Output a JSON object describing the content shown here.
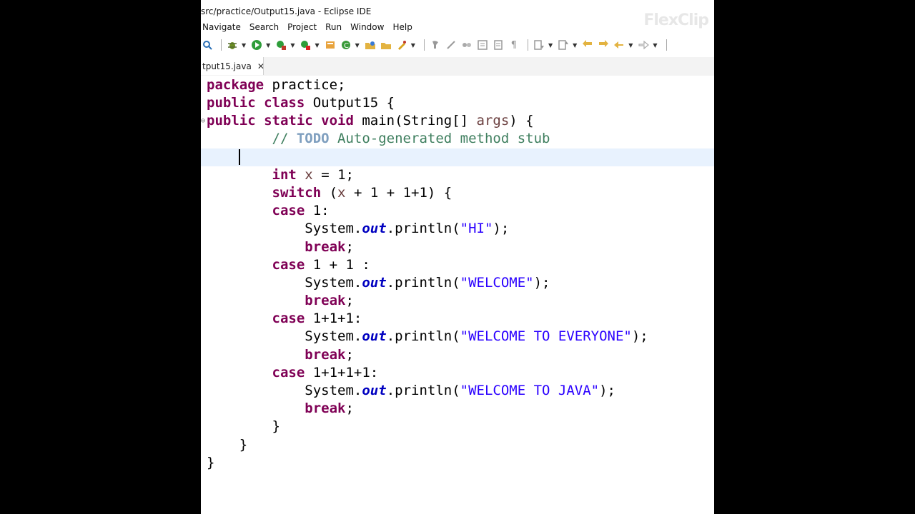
{
  "window": {
    "title": "src/practice/Output15.java - Eclipse IDE",
    "watermark": "FlexClip"
  },
  "menu": [
    "Navigate",
    "Search",
    "Project",
    "Run",
    "Window",
    "Help"
  ],
  "toolbar": {
    "icons": [
      "search-icon",
      "debug-icon",
      "run-icon",
      "coverage-icon",
      "external-tools-icon",
      "new-java-project-icon",
      "new-class-icon",
      "open-type-icon",
      "open-task-icon",
      "next-annotation-icon",
      "prev-annotation-icon",
      "highlight-icon",
      "toggle-block-icon",
      "show-whitespace-icon",
      "last-edit-icon",
      "next-edit-icon",
      "back-icon",
      "forward-icon"
    ]
  },
  "editor_tab": {
    "label": "tput15.java",
    "close": "✕"
  },
  "code": {
    "package_kw": "package",
    "package_name": " practice;",
    "public_kw": "public",
    "class_kw": " class",
    "class_name": " Output15 {",
    "static_kw": " static",
    "void_kw": " void",
    "main_sig": " main(String[] ",
    "args": "args",
    "main_end": ") {",
    "comment_prefix": "// ",
    "todo": "TODO",
    "comment_text": " Auto-generated method stub",
    "int_kw": "int",
    "x_var": "x",
    "int_rest": " = 1;",
    "switch_kw": "switch",
    "switch_open": " (",
    "switch_rest": " + 1 + 1+1) {",
    "case_kw": "case",
    "case1_label": " 1:",
    "case2_label": " 1 + 1 :",
    "case3_label": " 1+1+1:",
    "case4_label": " 1+1+1+1:",
    "system": "System.",
    "out": "out",
    "println": ".println(",
    "end": ");",
    "str1": "\"HI\"",
    "str2": "\"WELCOME\"",
    "str3": "\"WELCOME TO EVERYONE\"",
    "str4": "\"WELCOME TO JAVA\"",
    "break_kw": "break",
    "semicolon": ";",
    "close_brace": "}"
  }
}
